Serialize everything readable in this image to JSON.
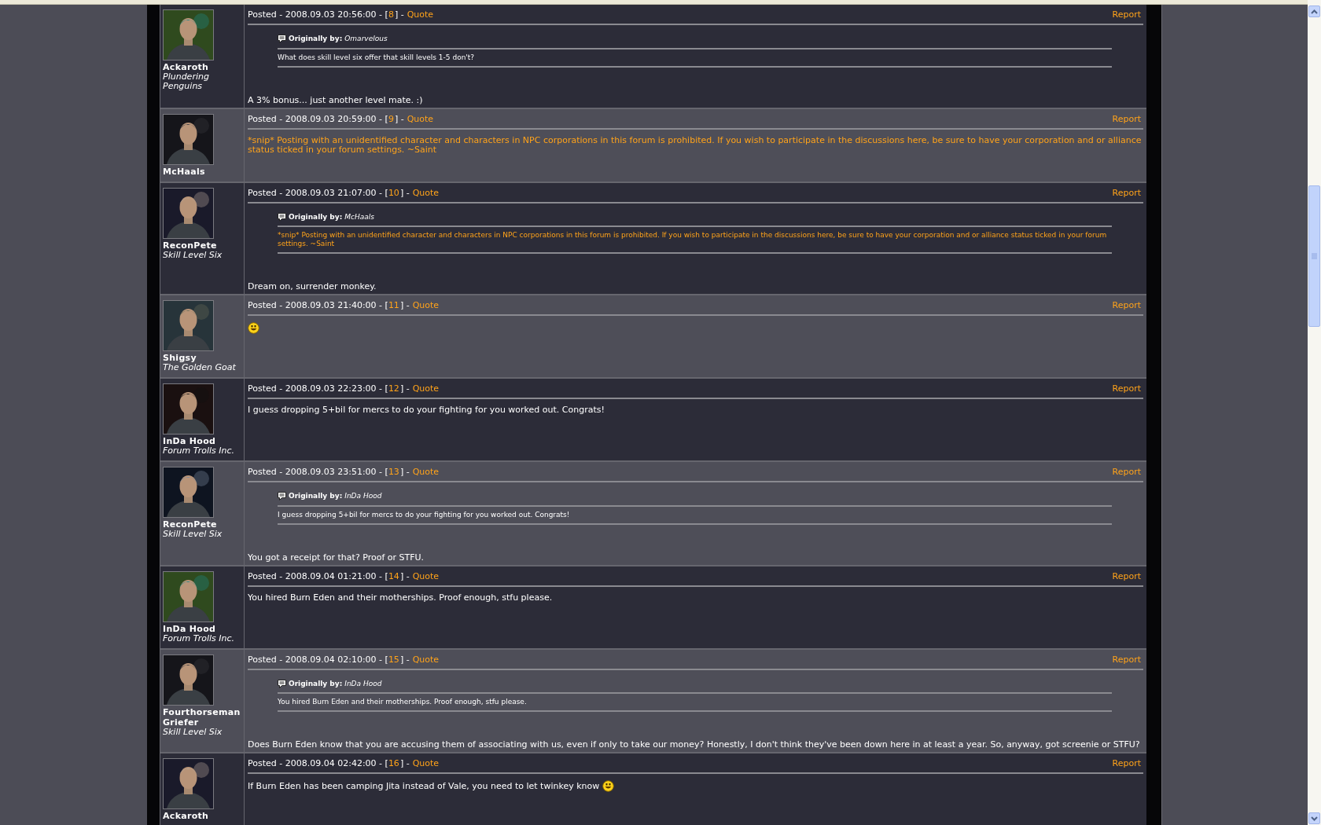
{
  "posts": [
    {
      "author": "Ackaroth",
      "title": "Plundering Penguins",
      "posted": "Posted - 2008.09.03 20:56:00 - [",
      "number": "8",
      "after_number": "] -",
      "quote_link": "Quote",
      "report": "Report",
      "quote": {
        "label": "Originally by:",
        "author": "Omarvelous",
        "text": "What does skill level six offer that skill levels 1-5 don't?",
        "moderated": false
      },
      "body": "A 3% bonus... just another level mate. :)",
      "moderated": false,
      "emoticon": false
    },
    {
      "author": "McHaals",
      "posted": "Posted - 2008.09.03 20:59:00 - [",
      "number": "9",
      "after_number": "] -",
      "quote_link": "Quote",
      "report": "Report",
      "body": "*snip* Posting with an unidentified character and characters in NPC corporations in this forum is prohibited. If you wish to participate in the discussions here, be sure to have your corporation and or alliance status ticked in your forum settings. ~Saint",
      "moderated": true,
      "emoticon": false
    },
    {
      "author": "ReconPete",
      "title": "Skill Level Six",
      "posted": "Posted - 2008.09.03 21:07:00 - [",
      "number": "10",
      "after_number": "] -",
      "quote_link": "Quote",
      "report": "Report",
      "quote": {
        "label": "Originally by:",
        "author": "McHaals",
        "text": "*snip* Posting with an unidentified character and characters in NPC corporations in this forum is prohibited. If you wish to participate in the discussions here, be sure to have your corporation and or alliance status ticked in your forum settings. ~Saint",
        "moderated": true
      },
      "body": "Dream on, surrender monkey.",
      "moderated": false,
      "emoticon": false
    },
    {
      "author": "Shigsy",
      "title": "The Golden Goat",
      "posted": "Posted - 2008.09.03 21:40:00 - [",
      "number": "11",
      "after_number": "] -",
      "quote_link": "Quote",
      "report": "Report",
      "moderated": false,
      "emoticon": true
    },
    {
      "author": "InDa Hood",
      "title": "Forum Trolls Inc.",
      "posted": "Posted - 2008.09.03 22:23:00 - [",
      "number": "12",
      "after_number": "] -",
      "quote_link": "Quote",
      "report": "Report",
      "body": "I guess dropping 5+bil for mercs to do your fighting for you worked out. Congrats!",
      "moderated": false,
      "emoticon": false
    },
    {
      "author": "ReconPete",
      "title": "Skill Level Six",
      "posted": "Posted - 2008.09.03 23:51:00 - [",
      "number": "13",
      "after_number": "] -",
      "quote_link": "Quote",
      "report": "Report",
      "quote": {
        "label": "Originally by:",
        "author": "InDa Hood",
        "text": "I guess dropping 5+bil for mercs to do your fighting for you worked out. Congrats!",
        "moderated": false
      },
      "body": "You got a receipt for that? Proof or STFU.",
      "moderated": false,
      "emoticon": false
    },
    {
      "author": "InDa Hood",
      "title": "Forum Trolls Inc.",
      "posted": "Posted - 2008.09.04 01:21:00 - [",
      "number": "14",
      "after_number": "] -",
      "quote_link": "Quote",
      "report": "Report",
      "body": "You hired Burn Eden and their motherships. Proof enough, stfu please.",
      "moderated": false,
      "emoticon": false
    },
    {
      "author": "Fourthorseman Griefer",
      "title": "Skill Level Six",
      "posted": "Posted - 2008.09.04 02:10:00 - [",
      "number": "15",
      "after_number": "] -",
      "quote_link": "Quote",
      "report": "Report",
      "quote": {
        "label": "Originally by:",
        "author": "InDa Hood",
        "text": "You hired Burn Eden and their motherships. Proof enough, stfu please.",
        "moderated": false
      },
      "body": "Does Burn Eden know that you are accusing them of associating with us, even if only to take our money? Honestly, I don't think they've been down here in at least a year. So, anyway, got screenie or STFU?",
      "moderated": false,
      "emoticon": false
    },
    {
      "author": "Ackaroth",
      "posted": "Posted - 2008.09.04 02:42:00 - [",
      "number": "16",
      "after_number": "] -",
      "quote_link": "Quote",
      "report": "Report",
      "body": "If Burn Eden has been camping Jita instead of Vale, you need to let twinkey know",
      "moderated": false,
      "emoticon": true
    }
  ]
}
